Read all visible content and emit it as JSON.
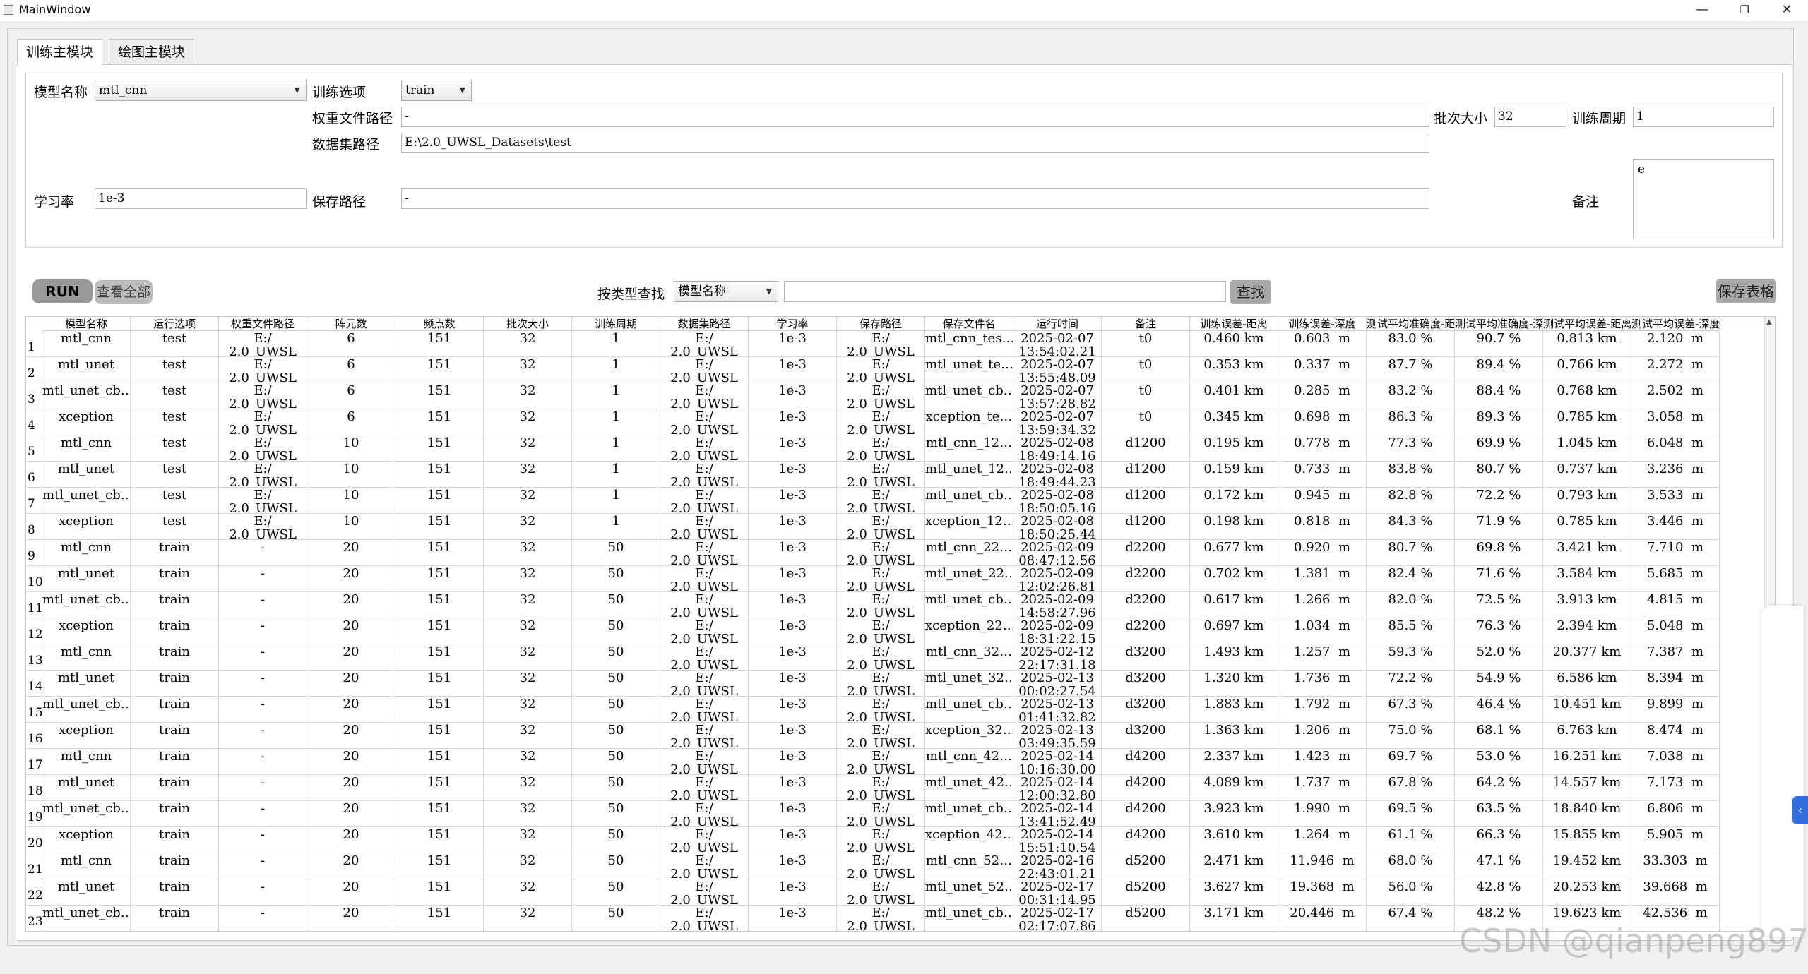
{
  "window": {
    "title": "MainWindow",
    "min": "—",
    "max": "❐",
    "close": "✕"
  },
  "tabs": [
    "训练主模块",
    "绘图主模块"
  ],
  "form": {
    "model_label": "模型名称",
    "model_value": "mtl_cnn",
    "train_option_label": "训练选项",
    "train_option_value": "train",
    "weight_path_label": "权重文件路径",
    "weight_path_value": "-",
    "batch_label": "批次大小",
    "batch_value": "32",
    "epoch_label": "训练周期",
    "epoch_value": "1",
    "dataset_label": "数据集路径",
    "dataset_value": "E:\\2.0_UWSL_Datasets\\test",
    "lr_label": "学习率",
    "lr_value": "1e-3",
    "save_label": "保存路径",
    "save_value": "-",
    "note_label": "备注",
    "note_value": "e"
  },
  "toolbar": {
    "run": "RUN",
    "view_all": "查看全部",
    "search_type_label": "按类型查找",
    "search_type_value": "模型名称",
    "search_value": "",
    "find": "查找",
    "save_table": "保存表格"
  },
  "table": {
    "columns": [
      "模型名称",
      "运行选项",
      "权重文件路径",
      "阵元数",
      "频点数",
      "批次大小",
      "训练周期",
      "数据集路径",
      "学习率",
      "保存路径",
      "保存文件名",
      "运行时间",
      "备注",
      "训练误差-距离",
      "训练误差-深度",
      "测试平均准确度-距离",
      "测试平均准确度-深度",
      "测试平均误差-距离",
      "测试平均误差-深度"
    ],
    "rows": [
      {
        "n": "1",
        "model": "mtl_cnn",
        "opt": "test",
        "w": "E:/\n2.0_UWSL",
        "arr": "6",
        "freq": "151",
        "batch": "32",
        "ep": "1",
        "ds": "E:/\n2.0_UWSL",
        "lr": "1e-3",
        "sp": "E:/\n2.0_UWSL",
        "sf": "mtl_cnn_tes…",
        "time": "2025-02-07\n13:54:02.21",
        "note": "t0",
        "ted": "0.460 km",
        "tedp": "0.603  m",
        "tad": "83.0 %",
        "tadp": "90.7 %",
        "terd": "0.813 km",
        "terdp": "2.120  m"
      },
      {
        "n": "2",
        "model": "mtl_unet",
        "opt": "test",
        "w": "E:/\n2.0_UWSL",
        "arr": "6",
        "freq": "151",
        "batch": "32",
        "ep": "1",
        "ds": "E:/\n2.0_UWSL",
        "lr": "1e-3",
        "sp": "E:/\n2.0_UWSL",
        "sf": "mtl_unet_te…",
        "time": "2025-02-07\n13:55:48.09",
        "note": "t0",
        "ted": "0.353 km",
        "tedp": "0.337  m",
        "tad": "87.7 %",
        "tadp": "89.4 %",
        "terd": "0.766 km",
        "terdp": "2.272  m"
      },
      {
        "n": "3",
        "model": "mtl_unet_cb…",
        "opt": "test",
        "w": "E:/\n2.0_UWSL",
        "arr": "6",
        "freq": "151",
        "batch": "32",
        "ep": "1",
        "ds": "E:/\n2.0_UWSL",
        "lr": "1e-3",
        "sp": "E:/\n2.0_UWSL",
        "sf": "mtl_unet_cb…",
        "time": "2025-02-07\n13:57:28.82",
        "note": "t0",
        "ted": "0.401 km",
        "tedp": "0.285  m",
        "tad": "83.2 %",
        "tadp": "88.4 %",
        "terd": "0.768 km",
        "terdp": "2.502  m"
      },
      {
        "n": "4",
        "model": "xception",
        "opt": "test",
        "w": "E:/\n2.0_UWSL",
        "arr": "6",
        "freq": "151",
        "batch": "32",
        "ep": "1",
        "ds": "E:/\n2.0_UWSL",
        "lr": "1e-3",
        "sp": "E:/\n2.0_UWSL",
        "sf": "xception_te…",
        "time": "2025-02-07\n13:59:34.32",
        "note": "t0",
        "ted": "0.345 km",
        "tedp": "0.698  m",
        "tad": "86.3 %",
        "tadp": "89.3 %",
        "terd": "0.785 km",
        "terdp": "3.058  m"
      },
      {
        "n": "5",
        "model": "mtl_cnn",
        "opt": "test",
        "w": "E:/\n2.0_UWSL",
        "arr": "10",
        "freq": "151",
        "batch": "32",
        "ep": "1",
        "ds": "E:/\n2.0_UWSL",
        "lr": "1e-3",
        "sp": "E:/\n2.0_UWSL",
        "sf": "mtl_cnn_12…",
        "time": "2025-02-08\n18:49:14.16",
        "note": "d1200",
        "ted": "0.195 km",
        "tedp": "0.778  m",
        "tad": "77.3 %",
        "tadp": "69.9 %",
        "terd": "1.045 km",
        "terdp": "6.048  m"
      },
      {
        "n": "6",
        "model": "mtl_unet",
        "opt": "test",
        "w": "E:/\n2.0_UWSL",
        "arr": "10",
        "freq": "151",
        "batch": "32",
        "ep": "1",
        "ds": "E:/\n2.0_UWSL",
        "lr": "1e-3",
        "sp": "E:/\n2.0_UWSL",
        "sf": "mtl_unet_12…",
        "time": "2025-02-08\n18:49:44.23",
        "note": "d1200",
        "ted": "0.159 km",
        "tedp": "0.733  m",
        "tad": "83.8 %",
        "tadp": "80.7 %",
        "terd": "0.737 km",
        "terdp": "3.236  m"
      },
      {
        "n": "7",
        "model": "mtl_unet_cb…",
        "opt": "test",
        "w": "E:/\n2.0_UWSL",
        "arr": "10",
        "freq": "151",
        "batch": "32",
        "ep": "1",
        "ds": "E:/\n2.0_UWSL",
        "lr": "1e-3",
        "sp": "E:/\n2.0_UWSL",
        "sf": "mtl_unet_cb…",
        "time": "2025-02-08\n18:50:05.16",
        "note": "d1200",
        "ted": "0.172 km",
        "tedp": "0.945  m",
        "tad": "82.8 %",
        "tadp": "72.2 %",
        "terd": "0.793 km",
        "terdp": "3.533  m"
      },
      {
        "n": "8",
        "model": "xception",
        "opt": "test",
        "w": "E:/\n2.0_UWSL",
        "arr": "10",
        "freq": "151",
        "batch": "32",
        "ep": "1",
        "ds": "E:/\n2.0_UWSL",
        "lr": "1e-3",
        "sp": "E:/\n2.0_UWSL",
        "sf": "xception_12…",
        "time": "2025-02-08\n18:50:25.44",
        "note": "d1200",
        "ted": "0.198 km",
        "tedp": "0.818  m",
        "tad": "84.3 %",
        "tadp": "71.9 %",
        "terd": "0.785 km",
        "terdp": "3.446  m"
      },
      {
        "n": "9",
        "model": "mtl_cnn",
        "opt": "train",
        "w": "-",
        "arr": "20",
        "freq": "151",
        "batch": "32",
        "ep": "50",
        "ds": "E:/\n2.0_UWSL",
        "lr": "1e-3",
        "sp": "E:/\n2.0_UWSL",
        "sf": "mtl_cnn_22…",
        "time": "2025-02-09\n08:47:12.56",
        "note": "d2200",
        "ted": "0.677 km",
        "tedp": "0.920  m",
        "tad": "80.7 %",
        "tadp": "69.8 %",
        "terd": "3.421 km",
        "terdp": "7.710  m"
      },
      {
        "n": "10",
        "model": "mtl_unet",
        "opt": "train",
        "w": "-",
        "arr": "20",
        "freq": "151",
        "batch": "32",
        "ep": "50",
        "ds": "E:/\n2.0_UWSL",
        "lr": "1e-3",
        "sp": "E:/\n2.0_UWSL",
        "sf": "mtl_unet_22…",
        "time": "2025-02-09\n12:02:26.81",
        "note": "d2200",
        "ted": "0.702 km",
        "tedp": "1.381  m",
        "tad": "82.4 %",
        "tadp": "71.6 %",
        "terd": "3.584 km",
        "terdp": "5.685  m"
      },
      {
        "n": "11",
        "model": "mtl_unet_cb…",
        "opt": "train",
        "w": "-",
        "arr": "20",
        "freq": "151",
        "batch": "32",
        "ep": "50",
        "ds": "E:/\n2.0_UWSL",
        "lr": "1e-3",
        "sp": "E:/\n2.0_UWSL",
        "sf": "mtl_unet_cb…",
        "time": "2025-02-09\n14:58:27.96",
        "note": "d2200",
        "ted": "0.617 km",
        "tedp": "1.266  m",
        "tad": "82.0 %",
        "tadp": "72.5 %",
        "terd": "3.913 km",
        "terdp": "4.815  m"
      },
      {
        "n": "12",
        "model": "xception",
        "opt": "train",
        "w": "-",
        "arr": "20",
        "freq": "151",
        "batch": "32",
        "ep": "50",
        "ds": "E:/\n2.0_UWSL",
        "lr": "1e-3",
        "sp": "E:/\n2.0_UWSL",
        "sf": "xception_22…",
        "time": "2025-02-09\n18:31:22.15",
        "note": "d2200",
        "ted": "0.697 km",
        "tedp": "1.034  m",
        "tad": "85.5 %",
        "tadp": "76.3 %",
        "terd": "2.394 km",
        "terdp": "5.048  m"
      },
      {
        "n": "13",
        "model": "mtl_cnn",
        "opt": "train",
        "w": "-",
        "arr": "20",
        "freq": "151",
        "batch": "32",
        "ep": "50",
        "ds": "E:/\n2.0_UWSL",
        "lr": "1e-3",
        "sp": "E:/\n2.0_UWSL",
        "sf": "mtl_cnn_32…",
        "time": "2025-02-12\n22:17:31.18",
        "note": "d3200",
        "ted": "1.493 km",
        "tedp": "1.257  m",
        "tad": "59.3 %",
        "tadp": "52.0 %",
        "terd": "20.377 km",
        "terdp": "7.387  m"
      },
      {
        "n": "14",
        "model": "mtl_unet",
        "opt": "train",
        "w": "-",
        "arr": "20",
        "freq": "151",
        "batch": "32",
        "ep": "50",
        "ds": "E:/\n2.0_UWSL",
        "lr": "1e-3",
        "sp": "E:/\n2.0_UWSL",
        "sf": "mtl_unet_32…",
        "time": "2025-02-13\n00:02:27.54",
        "note": "d3200",
        "ted": "1.320 km",
        "tedp": "1.736  m",
        "tad": "72.2 %",
        "tadp": "54.9 %",
        "terd": "6.586 km",
        "terdp": "8.394  m"
      },
      {
        "n": "15",
        "model": "mtl_unet_cb…",
        "opt": "train",
        "w": "-",
        "arr": "20",
        "freq": "151",
        "batch": "32",
        "ep": "50",
        "ds": "E:/\n2.0_UWSL",
        "lr": "1e-3",
        "sp": "E:/\n2.0_UWSL",
        "sf": "mtl_unet_cb…",
        "time": "2025-02-13\n01:41:32.82",
        "note": "d3200",
        "ted": "1.883 km",
        "tedp": "1.792  m",
        "tad": "67.3 %",
        "tadp": "46.4 %",
        "terd": "10.451 km",
        "terdp": "9.899  m"
      },
      {
        "n": "16",
        "model": "xception",
        "opt": "train",
        "w": "-",
        "arr": "20",
        "freq": "151",
        "batch": "32",
        "ep": "50",
        "ds": "E:/\n2.0_UWSL",
        "lr": "1e-3",
        "sp": "E:/\n2.0_UWSL",
        "sf": "xception_32…",
        "time": "2025-02-13\n03:49:35.59",
        "note": "d3200",
        "ted": "1.363 km",
        "tedp": "1.206  m",
        "tad": "75.0 %",
        "tadp": "68.1 %",
        "terd": "6.763 km",
        "terdp": "8.474  m"
      },
      {
        "n": "17",
        "model": "mtl_cnn",
        "opt": "train",
        "w": "-",
        "arr": "20",
        "freq": "151",
        "batch": "32",
        "ep": "50",
        "ds": "E:/\n2.0_UWSL",
        "lr": "1e-3",
        "sp": "E:/\n2.0_UWSL",
        "sf": "mtl_cnn_42…",
        "time": "2025-02-14\n10:16:30.00",
        "note": "d4200",
        "ted": "2.337 km",
        "tedp": "1.423  m",
        "tad": "69.7 %",
        "tadp": "53.0 %",
        "terd": "16.251 km",
        "terdp": "7.038  m"
      },
      {
        "n": "18",
        "model": "mtl_unet",
        "opt": "train",
        "w": "-",
        "arr": "20",
        "freq": "151",
        "batch": "32",
        "ep": "50",
        "ds": "E:/\n2.0_UWSL",
        "lr": "1e-3",
        "sp": "E:/\n2.0_UWSL",
        "sf": "mtl_unet_42…",
        "time": "2025-02-14\n12:00:32.80",
        "note": "d4200",
        "ted": "4.089 km",
        "tedp": "1.737  m",
        "tad": "67.8 %",
        "tadp": "64.2 %",
        "terd": "14.557 km",
        "terdp": "7.173  m"
      },
      {
        "n": "19",
        "model": "mtl_unet_cb…",
        "opt": "train",
        "w": "-",
        "arr": "20",
        "freq": "151",
        "batch": "32",
        "ep": "50",
        "ds": "E:/\n2.0_UWSL",
        "lr": "1e-3",
        "sp": "E:/\n2.0_UWSL",
        "sf": "mtl_unet_cb…",
        "time": "2025-02-14\n13:41:52.49",
        "note": "d4200",
        "ted": "3.923 km",
        "tedp": "1.990  m",
        "tad": "69.5 %",
        "tadp": "63.5 %",
        "terd": "18.840 km",
        "terdp": "6.806  m"
      },
      {
        "n": "20",
        "model": "xception",
        "opt": "train",
        "w": "-",
        "arr": "20",
        "freq": "151",
        "batch": "32",
        "ep": "50",
        "ds": "E:/\n2.0_UWSL",
        "lr": "1e-3",
        "sp": "E:/\n2.0_UWSL",
        "sf": "xception_42…",
        "time": "2025-02-14\n15:51:10.54",
        "note": "d4200",
        "ted": "3.610 km",
        "tedp": "1.264  m",
        "tad": "61.1 %",
        "tadp": "66.3 %",
        "terd": "15.855 km",
        "terdp": "5.905  m"
      },
      {
        "n": "21",
        "model": "mtl_cnn",
        "opt": "train",
        "w": "-",
        "arr": "20",
        "freq": "151",
        "batch": "32",
        "ep": "50",
        "ds": "E:/\n2.0_UWSL",
        "lr": "1e-3",
        "sp": "E:/\n2.0_UWSL",
        "sf": "mtl_cnn_52…",
        "time": "2025-02-16\n22:43:01.21",
        "note": "d5200",
        "ted": "2.471 km",
        "tedp": "11.946  m",
        "tad": "68.0 %",
        "tadp": "47.1 %",
        "terd": "19.452 km",
        "terdp": "33.303  m"
      },
      {
        "n": "22",
        "model": "mtl_unet",
        "opt": "train",
        "w": "-",
        "arr": "20",
        "freq": "151",
        "batch": "32",
        "ep": "50",
        "ds": "E:/\n2.0_UWSL",
        "lr": "1e-3",
        "sp": "E:/\n2.0_UWSL",
        "sf": "mtl_unet_52…",
        "time": "2025-02-17\n00:31:14.95",
        "note": "d5200",
        "ted": "3.627 km",
        "tedp": "19.368  m",
        "tad": "56.0 %",
        "tadp": "42.8 %",
        "terd": "20.253 km",
        "terdp": "39.668  m"
      },
      {
        "n": "23",
        "model": "mtl_unet_cb…",
        "opt": "train",
        "w": "-",
        "arr": "20",
        "freq": "151",
        "batch": "32",
        "ep": "50",
        "ds": "E:/\n2.0_UWSL",
        "lr": "1e-3",
        "sp": "E:/\n2.0_UWSL",
        "sf": "mtl_unet_cb…",
        "time": "2025-02-17\n02:17:07.86",
        "note": "d5200",
        "ted": "3.171 km",
        "tedp": "20.446  m",
        "tad": "67.4 %",
        "tadp": "48.2 %",
        "terd": "19.623 km",
        "terdp": "42.536  m"
      }
    ]
  },
  "watermark": "CSDN @qianpeng897"
}
